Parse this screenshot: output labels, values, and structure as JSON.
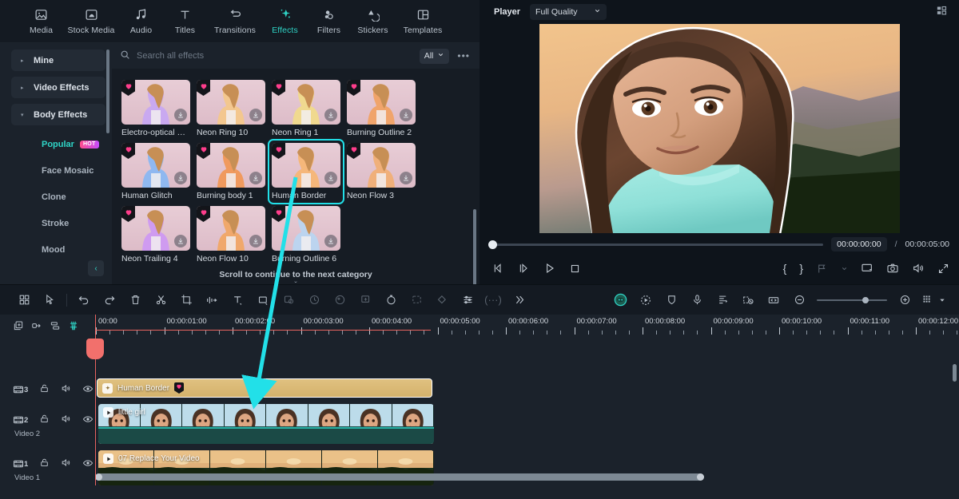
{
  "app": {
    "accent": "#2fd4c6",
    "highlight": "#22e0e8",
    "playhead_color": "#e8635f"
  },
  "tabs": [
    {
      "label": "Media",
      "icon": "media-icon",
      "active": false
    },
    {
      "label": "Stock Media",
      "icon": "stock-media-icon",
      "active": false
    },
    {
      "label": "Audio",
      "icon": "audio-note-icon",
      "active": false
    },
    {
      "label": "Titles",
      "icon": "titles-text-icon",
      "active": false
    },
    {
      "label": "Transitions",
      "icon": "transitions-arrow-icon",
      "active": false
    },
    {
      "label": "Effects",
      "icon": "effects-sparkle-icon",
      "active": true
    },
    {
      "label": "Filters",
      "icon": "filters-circles-icon",
      "active": false
    },
    {
      "label": "Stickers",
      "icon": "stickers-icon",
      "active": false
    },
    {
      "label": "Templates",
      "icon": "templates-layout-icon",
      "active": false
    }
  ],
  "sidebar": {
    "categories": [
      {
        "label": "Mine",
        "expanded": false
      },
      {
        "label": "Video Effects",
        "expanded": false
      },
      {
        "label": "Body Effects",
        "expanded": true
      }
    ],
    "subcategories": [
      {
        "label": "Popular",
        "badge": "HOT",
        "selected": true
      },
      {
        "label": "Face Mosaic",
        "badge": "",
        "selected": false
      },
      {
        "label": "Clone",
        "badge": "",
        "selected": false
      },
      {
        "label": "Stroke",
        "badge": "",
        "selected": false
      },
      {
        "label": "Mood",
        "badge": "",
        "selected": false
      }
    ],
    "collapse_label": "‹"
  },
  "search": {
    "placeholder": "Search all effects",
    "value": "",
    "filter_label": "All",
    "more_label": "•••"
  },
  "effects": {
    "items": [
      {
        "name": "Electro-optical …",
        "selected": false,
        "tint": "#c9a9f0"
      },
      {
        "name": "Neon Ring 10",
        "selected": false,
        "tint": "#f3c78f"
      },
      {
        "name": "Neon Ring 1",
        "selected": false,
        "tint": "#f0d98f"
      },
      {
        "name": "Burning Outline 2",
        "selected": false,
        "tint": "#f0a46b"
      },
      {
        "name": "Human Glitch",
        "selected": false,
        "tint": "#8fb8f0"
      },
      {
        "name": "Burning body 1",
        "selected": false,
        "tint": "#f09a5e"
      },
      {
        "name": "Human Border",
        "selected": true,
        "tint": "#f5b77a"
      },
      {
        "name": "Neon Flow 3",
        "selected": false,
        "tint": "#f0b07a"
      },
      {
        "name": "Neon Trailing 4",
        "selected": false,
        "tint": "#cf9bf0"
      },
      {
        "name": "Neon Flow 10",
        "selected": false,
        "tint": "#f0a86b"
      },
      {
        "name": "Burning Outline 6",
        "selected": false,
        "tint": "#bcd4ef"
      }
    ],
    "scroll_note": "Scroll to continue to the next category",
    "scroll_chevron": "ˇ"
  },
  "player": {
    "title": "Player",
    "quality": "Full Quality",
    "current_time": "00:00:00:00",
    "separator": "/",
    "total_time": "00:00:05:00",
    "controls": [
      {
        "name": "prev-frame-button",
        "glyph": "prev-frame-icon"
      },
      {
        "name": "next-frame-button",
        "glyph": "next-frame-icon"
      },
      {
        "name": "play-button",
        "glyph": "play-icon"
      },
      {
        "name": "stop-button",
        "glyph": "stop-icon"
      }
    ],
    "right_controls": [
      {
        "name": "mark-in-button",
        "label": "{"
      },
      {
        "name": "mark-out-button",
        "label": "}"
      },
      {
        "name": "markers-button",
        "label": ""
      },
      {
        "name": "fullscreen-toggle-button",
        "label": ""
      },
      {
        "name": "snapshot-button",
        "label": ""
      },
      {
        "name": "volume-button",
        "label": ""
      },
      {
        "name": "expand-button",
        "label": ""
      }
    ]
  },
  "toolbar": {
    "left_tools": [
      "grid-view-icon",
      "select-tool-icon",
      "divider",
      "undo-icon",
      "redo-icon",
      "delete-icon",
      "split-scissors-icon",
      "crop-icon",
      "speed-icon",
      "text-icon",
      "mask-icon",
      "green-screen-icon",
      "stabilize-icon",
      "color-match-icon",
      "motion-tracking-icon",
      "freeze-frame-icon",
      "auto-reframe-icon",
      "keyframe-icon",
      "audio-mixer-icon",
      "more-dots-icon",
      "chevrons-right-icon"
    ],
    "right_tools": [
      "ai-assistant-icon",
      "auto-beat-icon",
      "shield-icon",
      "microphone-icon",
      "subtitle-icon",
      "screen-record-icon",
      "fit-timeline-icon"
    ],
    "zoom_out": "−",
    "zoom_in": "+",
    "layout_icon": "layout-grid-icon"
  },
  "timeline": {
    "tools": [
      "add-track-icon",
      "link-icon",
      "merge-icon",
      "marker-icon"
    ],
    "ruler_labels": [
      "00:00",
      "00:00:01:00",
      "00:00:02:00",
      "00:00:03:00",
      "00:00:04:00",
      "00:00:05:00",
      "00:00:06:00",
      "00:00:07:00",
      "00:00:08:00",
      "00:00:09:00",
      "00:00:10:00",
      "00:00:11:00",
      "00:00:12:00"
    ],
    "tracks": [
      {
        "number": "3",
        "name": "",
        "type": "effect"
      },
      {
        "number": "2",
        "name": "Video 2",
        "type": "video"
      },
      {
        "number": "1",
        "name": "Video 1",
        "type": "video"
      }
    ],
    "clips": [
      {
        "title": "Human Border",
        "track": 3,
        "kind": "effect",
        "badge": "heart-icon"
      },
      {
        "title": "little girl",
        "track": 2,
        "kind": "video"
      },
      {
        "title": "07 Replace Your Video",
        "track": 1,
        "kind": "video"
      }
    ]
  },
  "annotation": {
    "type": "arrow",
    "color": "#22e0e8",
    "from": "Human Border effect card",
    "to": "Human Border timeline clip"
  }
}
